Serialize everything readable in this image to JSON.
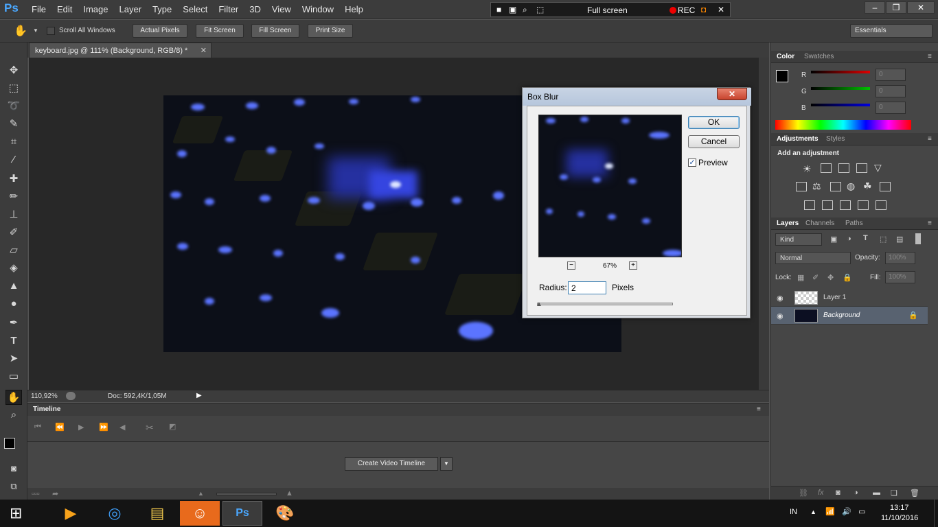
{
  "app": {
    "logo": "Ps",
    "menu": [
      "File",
      "Edit",
      "Image",
      "Layer",
      "Type",
      "Select",
      "Filter",
      "3D",
      "View",
      "Window",
      "Help"
    ]
  },
  "recorder": {
    "label": "Full screen",
    "rec": "REC"
  },
  "options": {
    "scroll_all": "Scroll All Windows",
    "actual_pixels": "Actual Pixels",
    "fit_screen": "Fit Screen",
    "fill_screen": "Fill Screen",
    "print_size": "Print Size",
    "workspace": "Essentials"
  },
  "document": {
    "tab": "keyboard.jpg @ 111% (Background, RGB/8) *",
    "zoom": "110,92%",
    "doc_info": "Doc: 592,4K/1,05M"
  },
  "timeline": {
    "title": "Timeline",
    "create_button": "Create Video Timeline"
  },
  "color_panel": {
    "tabs": [
      "Color",
      "Swatches"
    ],
    "channels": [
      {
        "label": "R",
        "value": "0",
        "color": "#e00000"
      },
      {
        "label": "G",
        "value": "0",
        "color": "#00c000"
      },
      {
        "label": "B",
        "value": "0",
        "color": "#0000e0"
      }
    ]
  },
  "adjustments_panel": {
    "tabs": [
      "Adjustments",
      "Styles"
    ],
    "heading": "Add an adjustment"
  },
  "layers_panel": {
    "tabs": [
      "Layers",
      "Channels",
      "Paths"
    ],
    "kind": "Kind",
    "blend_mode": "Normal",
    "opacity_label": "Opacity:",
    "opacity_value": "100%",
    "lock_label": "Lock:",
    "fill_label": "Fill:",
    "fill_value": "100%",
    "layers": [
      {
        "name": "Layer 1"
      },
      {
        "name": "Background"
      }
    ]
  },
  "dialog": {
    "title": "Box Blur",
    "ok": "OK",
    "cancel": "Cancel",
    "preview_label": "Preview",
    "preview_checked": true,
    "zoom": "67%",
    "radius_label": "Radius:",
    "radius_value": "2",
    "units": "Pixels"
  },
  "taskbar": {
    "lang": "IN",
    "time": "13:17",
    "date": "11/10/2016"
  }
}
